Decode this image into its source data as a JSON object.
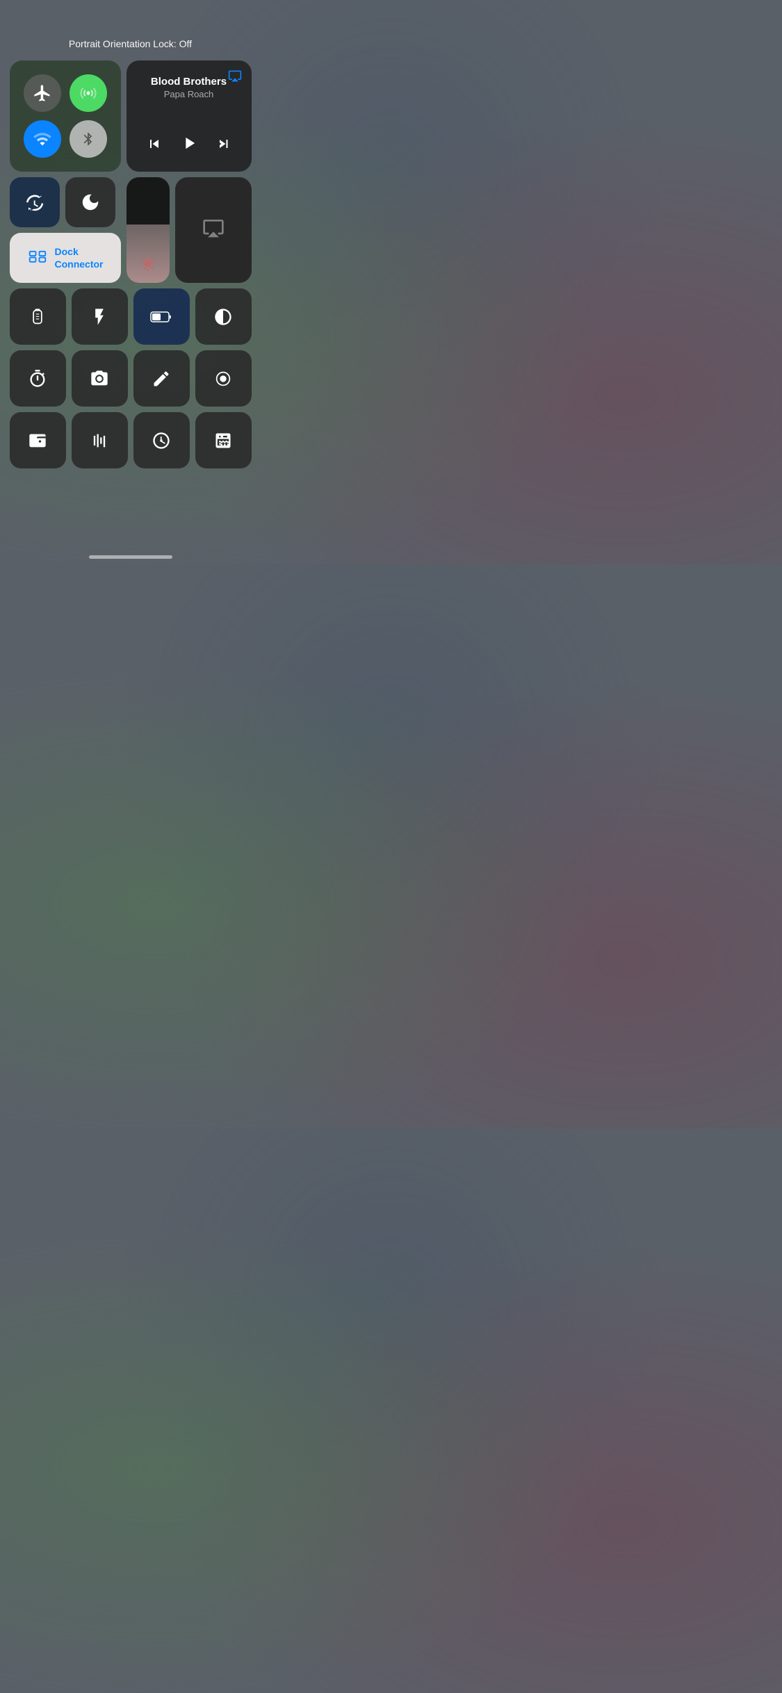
{
  "statusText": "Portrait Orientation Lock: Off",
  "network": {
    "airplaneLabel": "✈",
    "wifiSignalLabel": "📶",
    "wifiLabel": "wifi",
    "bluetoothLabel": "bluetooth"
  },
  "nowPlaying": {
    "title": "Blood Brothers",
    "artist": "Papa Roach",
    "prevLabel": "⏮",
    "playLabel": "▶",
    "nextLabel": "⏭"
  },
  "dockConnector": {
    "label": "Dock\nConnector"
  },
  "controls": {
    "rotation_label": "rotation-lock",
    "dnd_label": "do-not-disturb"
  },
  "iconRows": [
    [
      {
        "name": "remote",
        "label": "remote"
      },
      {
        "name": "flashlight",
        "label": "flashlight"
      },
      {
        "name": "battery",
        "label": "battery"
      },
      {
        "name": "invert",
        "label": "invert-colors"
      }
    ],
    [
      {
        "name": "timer",
        "label": "timer"
      },
      {
        "name": "camera",
        "label": "camera"
      },
      {
        "name": "notes",
        "label": "notes"
      },
      {
        "name": "record",
        "label": "screen-record"
      }
    ],
    [
      {
        "name": "wallet",
        "label": "wallet"
      },
      {
        "name": "soundcheck",
        "label": "soundcheck"
      },
      {
        "name": "clock",
        "label": "clock"
      },
      {
        "name": "calculator",
        "label": "calculator"
      }
    ]
  ],
  "homeBar": "home-indicator"
}
